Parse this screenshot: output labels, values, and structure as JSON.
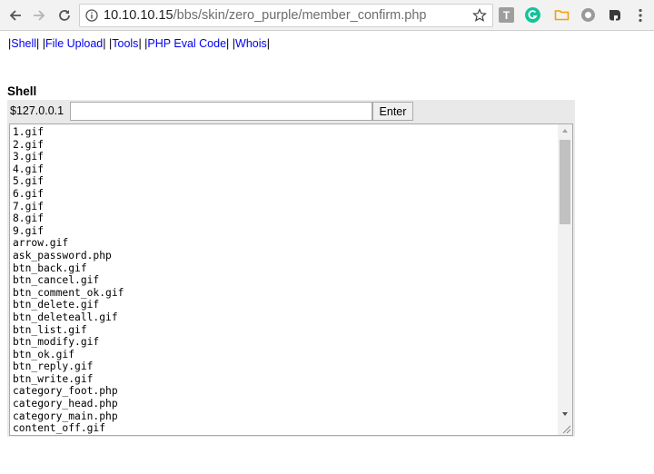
{
  "browser": {
    "url_host": "10.10.10.15",
    "url_path": "/bbs/skin/zero_purple/member_confirm.php",
    "extension_t_label": "T",
    "icons": [
      "back-arrow-icon",
      "forward-arrow-icon",
      "reload-icon",
      "info-icon",
      "star-icon",
      "grammarly-icon",
      "folder-icon",
      "circle-icon",
      "evernote-icon",
      "menu-icon"
    ]
  },
  "nav": {
    "pipe": "|",
    "links": [
      "Shell",
      "File Upload",
      "Tools",
      "PHP Eval Code",
      "Whois"
    ],
    "link_color": "#0000ee"
  },
  "shell": {
    "heading": "Shell",
    "prompt": "$127.0.0.1",
    "input_value": "",
    "enter_label": "Enter",
    "files": [
      "1.gif",
      "2.gif",
      "3.gif",
      "4.gif",
      "5.gif",
      "6.gif",
      "7.gif",
      "8.gif",
      "9.gif",
      "arrow.gif",
      "ask_password.php",
      "btn_back.gif",
      "btn_cancel.gif",
      "btn_comment_ok.gif",
      "btn_delete.gif",
      "btn_deleteall.gif",
      "btn_list.gif",
      "btn_modify.gif",
      "btn_ok.gif",
      "btn_reply.gif",
      "btn_write.gif",
      "category_foot.php",
      "category_head.php",
      "category_main.php",
      "content_off.gif"
    ]
  }
}
